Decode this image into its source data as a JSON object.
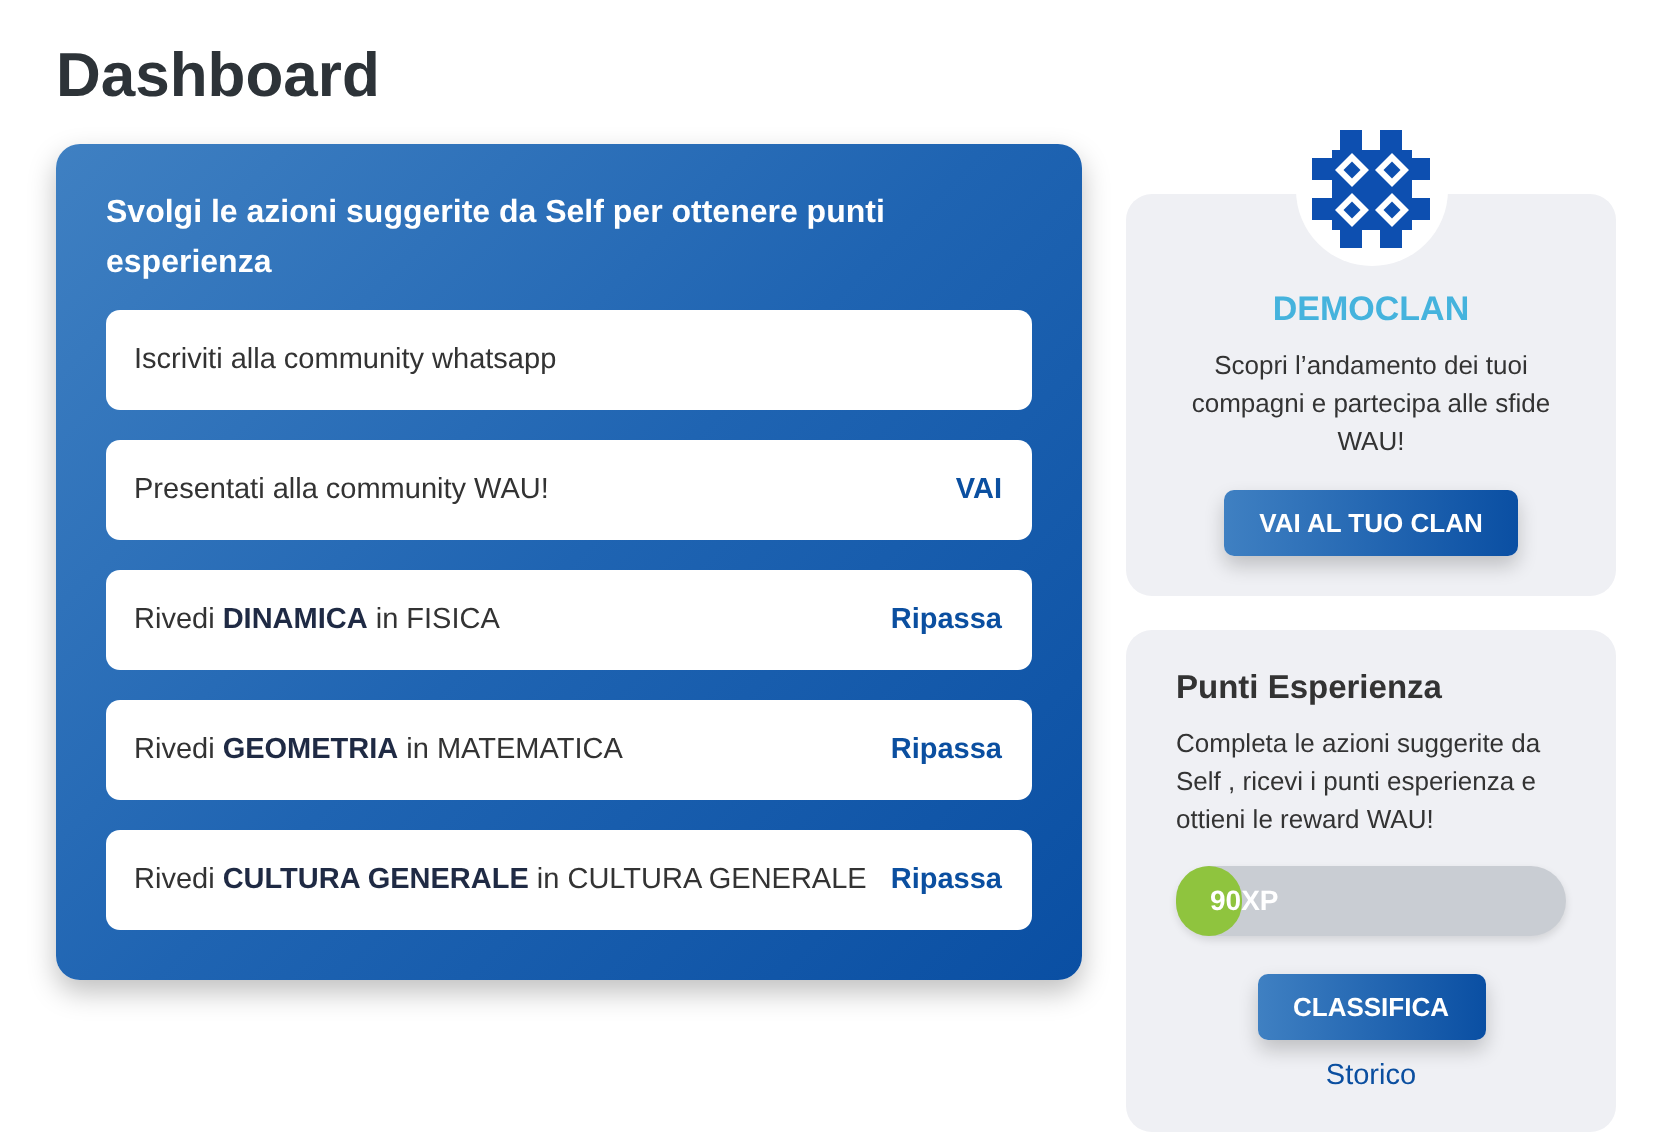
{
  "page": {
    "title": "Dashboard"
  },
  "suggestions": {
    "heading": "Svolgi le azioni suggerite da Self per ottenere punti esperienza",
    "items": [
      {
        "text": "Iscriviti alla community whatsapp"
      },
      {
        "text": "Presentati alla community WAU!",
        "action": "VAI"
      },
      {
        "text": "Rivedi **DINAMICA** in FISICA",
        "action": "Ripassa"
      },
      {
        "text": "Rivedi **GEOMETRIA** in MATEMATICA",
        "action": "Ripassa"
      },
      {
        "text": "Rivedi **CULTURA GENERALE** in CULTURA GENERALE",
        "action": "Ripassa"
      }
    ]
  },
  "clan": {
    "name": "DEMOCLAN",
    "description": "Scopri l’andamento dei tuoi compagni e partecipa alle sfide WAU!",
    "button": "VAI AL TUO CLAN"
  },
  "experience": {
    "title": "Punti Esperienza",
    "description": "Completa le azioni suggerite da Self , ricevi i punti esperienza e ottieni le reward WAU!",
    "level": 0.17,
    "reading": "90XP",
    "button": "CLASSIFICA",
    "link": "Storico"
  }
}
